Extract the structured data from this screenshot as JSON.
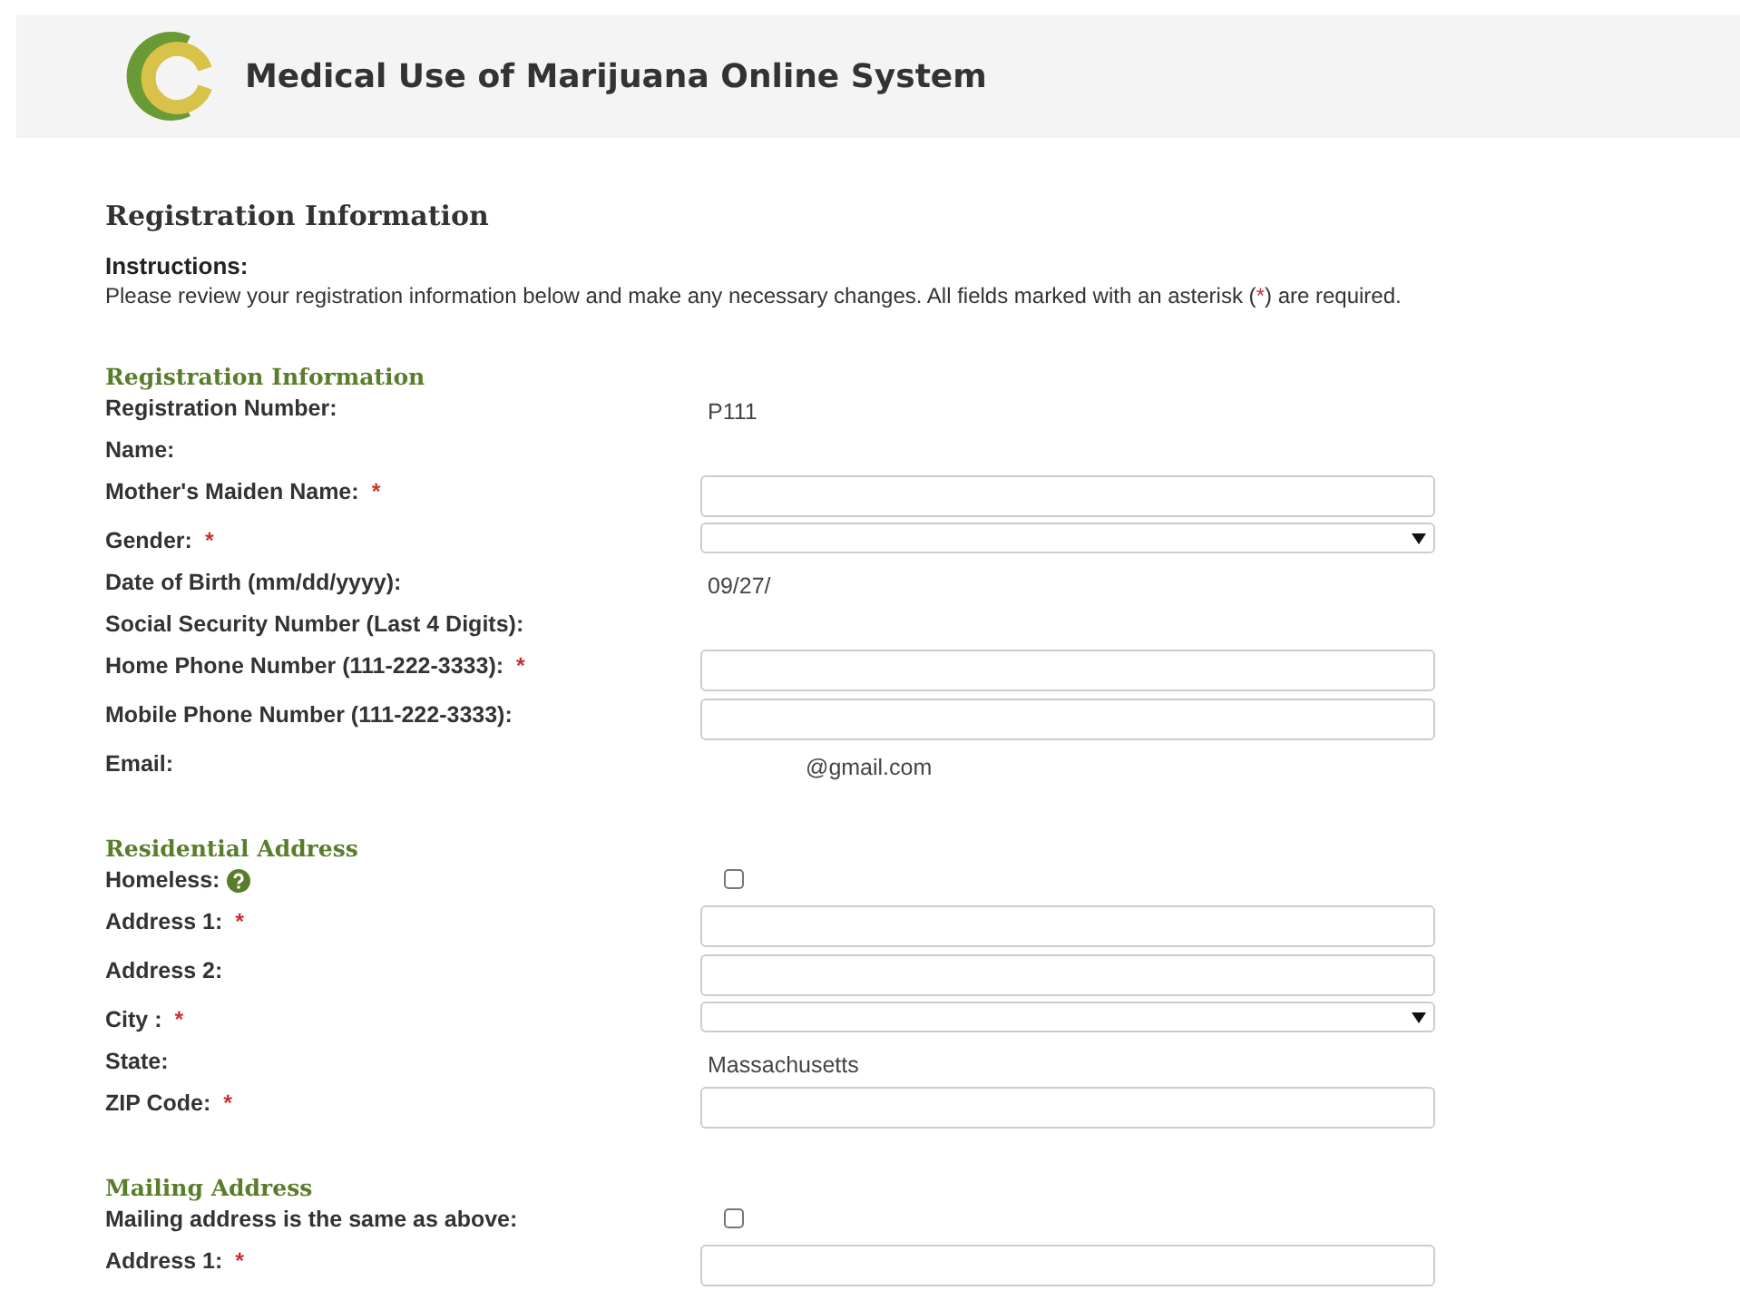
{
  "header": {
    "title": "Medical Use of Marijuana Online System"
  },
  "page_title": "Registration Information",
  "instructions": {
    "heading": "Instructions:",
    "text_before": "Please review your registration information below and make any necessary changes. All fields marked with an asterisk (",
    "asterisk": "*",
    "text_after": ") are required."
  },
  "sections": [
    {
      "title": "Registration Information",
      "rows": [
        {
          "label": "Registration Number:",
          "kind": "text",
          "value": "P111",
          "required": false
        },
        {
          "label": "Name:",
          "kind": "empty",
          "required": false
        },
        {
          "label": "Mother's Maiden Name:",
          "kind": "input",
          "required": true
        },
        {
          "label": "Gender:",
          "kind": "select",
          "required": true
        },
        {
          "label": "Date of Birth (mm/dd/yyyy):",
          "kind": "text",
          "value": "09/27/",
          "required": false
        },
        {
          "label": "Social Security Number (Last 4 Digits):",
          "kind": "empty",
          "required": false
        },
        {
          "label": "Home Phone Number (111-222-3333):",
          "kind": "input",
          "required": true
        },
        {
          "label": "Mobile Phone Number (111-222-3333):",
          "kind": "input",
          "required": false
        },
        {
          "label": "Email:",
          "kind": "email",
          "value": "@gmail.com",
          "required": false
        }
      ]
    },
    {
      "title": "Residential Address",
      "rows": [
        {
          "label": "Homeless:",
          "kind": "checkbox",
          "checked": false,
          "help": true,
          "required": false
        },
        {
          "label": "Address 1:",
          "kind": "input",
          "required": true
        },
        {
          "label": "Address 2:",
          "kind": "input",
          "required": false
        },
        {
          "label": "City :",
          "kind": "select",
          "required": true
        },
        {
          "label": "State:",
          "kind": "text",
          "value": "Massachusetts",
          "required": false
        },
        {
          "label": "ZIP Code:",
          "kind": "input",
          "required": true
        }
      ]
    },
    {
      "title": "Mailing Address",
      "rows": [
        {
          "label": "Mailing address is the same as above:",
          "kind": "checkbox",
          "checked": false,
          "required": false
        },
        {
          "label": "Address 1:",
          "kind": "input",
          "required": true
        }
      ]
    }
  ]
}
